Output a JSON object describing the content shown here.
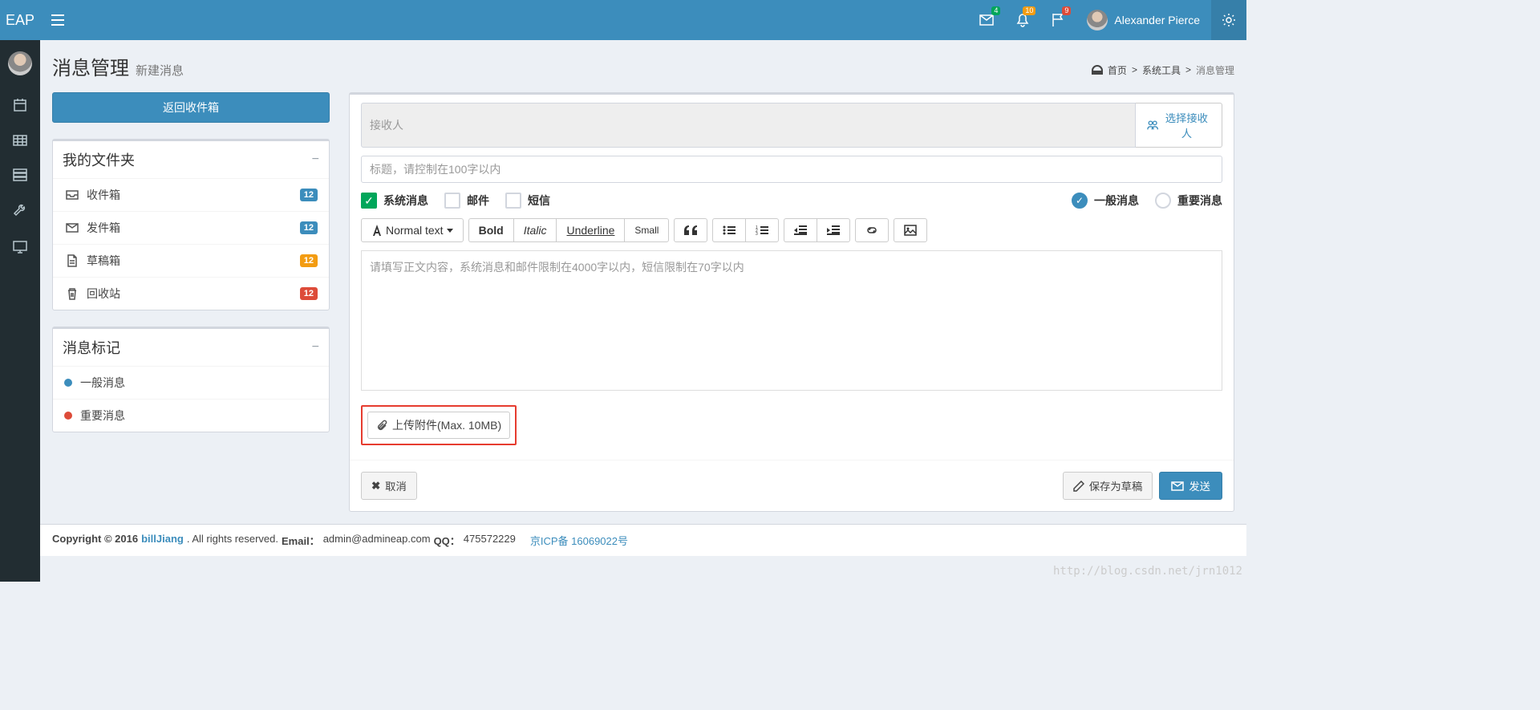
{
  "header": {
    "logo": "EAP",
    "badges": {
      "mail": "4",
      "bell": "10",
      "flag": "9"
    },
    "username": "Alexander Pierce"
  },
  "page": {
    "title": "消息管理",
    "subtitle": "新建消息"
  },
  "breadcrumb": {
    "home": "首页",
    "tools": "系统工具",
    "current": "消息管理"
  },
  "sidebar": {
    "back_btn": "返回收件箱",
    "folders_title": "我的文件夹",
    "folders": [
      {
        "label": "收件箱",
        "count": "12",
        "color": "blue"
      },
      {
        "label": "发件箱",
        "count": "12",
        "color": "blue"
      },
      {
        "label": "草稿箱",
        "count": "12",
        "color": "orange"
      },
      {
        "label": "回收站",
        "count": "12",
        "color": "red"
      }
    ],
    "tags_title": "消息标记",
    "tags": [
      {
        "label": "一般消息",
        "color": "dot-blue"
      },
      {
        "label": "重要消息",
        "color": "dot-red"
      }
    ]
  },
  "compose": {
    "recipient_placeholder": "接收人",
    "select_recipient": "选择接收人",
    "title_placeholder": "标题，请控制在100字以内",
    "types": {
      "system": "系统消息",
      "email": "邮件",
      "sms": "短信"
    },
    "priority": {
      "normal": "一般消息",
      "important": "重要消息"
    },
    "toolbar": {
      "normal": "Normal text",
      "bold": "Bold",
      "italic": "Italic",
      "underline": "Underline",
      "small": "Small"
    },
    "body_placeholder": "请填写正文内容，系统消息和邮件限制在4000字以内，短信限制在70字以内",
    "attach": "上传附件(Max. 10MB)",
    "cancel": "取消",
    "draft": "保存为草稿",
    "send": "发送"
  },
  "footer": {
    "copyright": "Copyright © 2016",
    "author": "billJiang",
    "rights": ". All rights reserved.",
    "email_label": "Email：",
    "email": "admin@admineap.com",
    "qq_label": "QQ：",
    "qq": "475572229",
    "icp": "京ICP备 16069022号"
  },
  "watermark": "http://blog.csdn.net/jrn1012"
}
